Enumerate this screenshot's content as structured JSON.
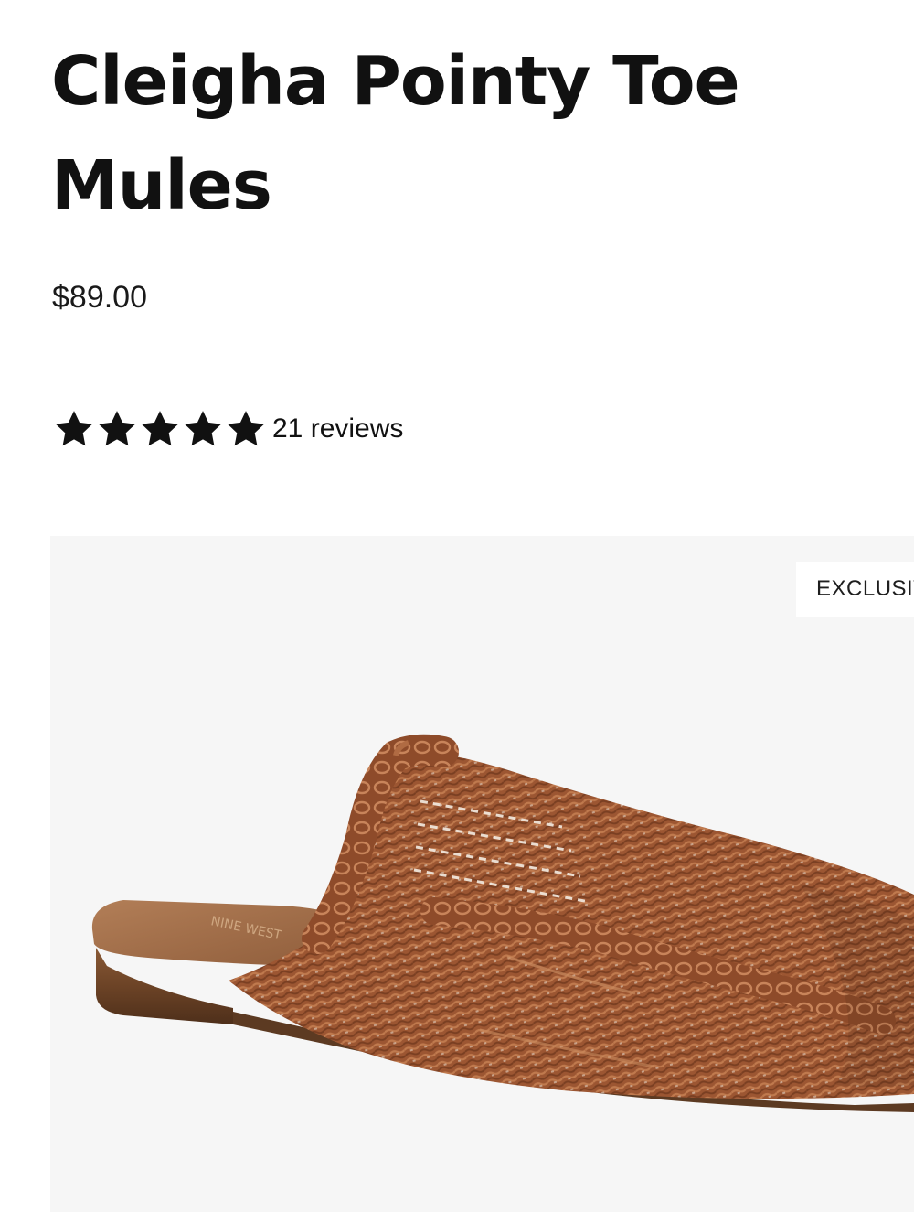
{
  "product": {
    "title": "Cleigha Pointy Toe Mules",
    "price": "$89.00",
    "rating": {
      "stars": 5,
      "max_stars": 5,
      "reviews_label": "21 reviews"
    },
    "badge": "EXCLUSIVE",
    "image": {
      "icon": "woven-mule-shoe",
      "insole_logo": "NINE WEST"
    }
  },
  "colors": {
    "text": "#111111",
    "gallery_bg": "#f6f6f6",
    "shoe_weave": "#9c5632",
    "shoe_insole": "#a4714c"
  }
}
